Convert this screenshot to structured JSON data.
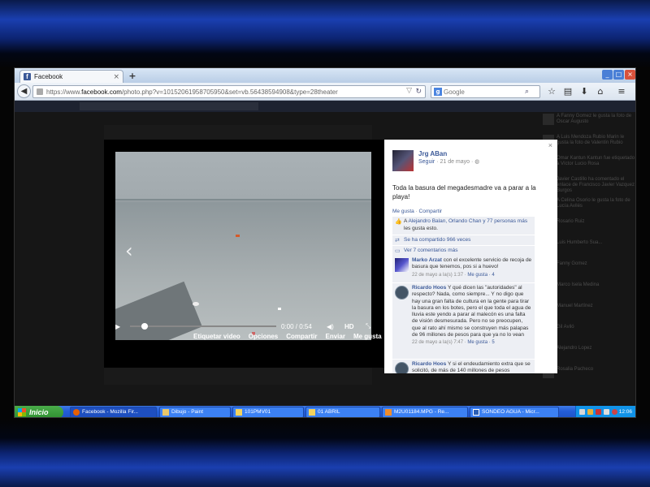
{
  "browser": {
    "tab_title": "Facebook",
    "favicon_letter": "f",
    "new_tab_symbol": "+",
    "tab_close_symbol": "×",
    "url_prefix": "https://www.",
    "url_domain": "facebook.com",
    "url_rest": "/photo.php?v=10152061958705950&set=vb.56438594908&type=28theater",
    "search_engine": "Google",
    "search_placeholder": "Google",
    "window_buttons": [
      "_",
      "□",
      "×"
    ]
  },
  "video": {
    "time": "0:00 / 0:54",
    "hd_label": "HD",
    "progress": 0.0,
    "prev_arrow": "‹",
    "next_arrow": "›"
  },
  "actions": [
    "Etiquetar video",
    "Opciones",
    "Compartir",
    "Enviar",
    "Me gusta"
  ],
  "post": {
    "author": "Jrg ABan",
    "follow": "Seguir",
    "date": "· 21 de mayo ·",
    "text": "Toda la basura del megadesmadre va a parar a la playa!",
    "link_like": "Me gusta",
    "link_share": "Compartir",
    "close_symbol": "×"
  },
  "summary": {
    "likes_prefix": "A",
    "likes_names": "Alejandro Balan, Orlando Chan y 77 personas más",
    "likes_suffix": "les gusta esto.",
    "shares": "Se ha compartido 966 veces",
    "more_comments": "Ver 7 comentarios más"
  },
  "comments": [
    {
      "author": "Marko Arzat",
      "text": "con el excelente servicio de recoja de basura que tenemos, pos si a huevo!",
      "date": "22 de mayo a la(s) 1:37 ·",
      "like": "Me gusta",
      "count": "· 4"
    },
    {
      "author": "Ricardo Hoos",
      "text": "Y qué dicen las \"autoridades\" al respecto? Nada, como siempre... Y no digo que hay una gran falta de cultura en la gente para tirar la basura en los botes, pero el que toda el agua de lluvia este yendo a parar al malecón es una falta de visión desmesurada. Pero no se preocupen, que al rato ahí mismo se construyen más palapas de 96 millones de pesos para que ya no lo vean",
      "date": "22 de mayo a la(s) 7:47 ·",
      "like": "Me gusta",
      "count": "· 5"
    },
    {
      "author": "Ricardo Hoos",
      "text": "Y si el endeudamiento extra que se solicitó, de más de 140 millones de pesos",
      "date": "",
      "like": "",
      "count": ""
    }
  ],
  "ticker": [
    "A Fanny Gomez le gusta la foto de Oscar Augusto",
    "A Luis Mendoza Rubio Marin le gusta la foto de Valentín Rubio",
    "Omar Kantun Kantun fue etiquetado a Víctor Lucio Rosa",
    "Javier Castillo ha comentado el enlace de Francisco Javier Vazquez Burgos",
    "A Celina Osorio le gusta la foto de Lucía Avilés",
    "Rosario Ruiz",
    "Luis Humberto Sua...",
    "Fanny Gomez",
    "Marco Isela Medina",
    "Manuel Martínez",
    "Gil Aviló",
    "Alejandro Lopez",
    "Rosalia Pacheco"
  ],
  "taskbar": {
    "start_label": "Inicio",
    "tasks": [
      "Facebook - Mozilla Fir...",
      "Dibujo - Paint",
      "101PMV01",
      "01 ABRIL",
      "M2U01184.MPG - Re...",
      "SONDEO AGUA - Micr..."
    ],
    "clock": "12:06"
  },
  "colors": {
    "fb_blue": "#3b5998",
    "xp_taskbar": "#245ed8",
    "xp_start": "#3a9c3a"
  }
}
